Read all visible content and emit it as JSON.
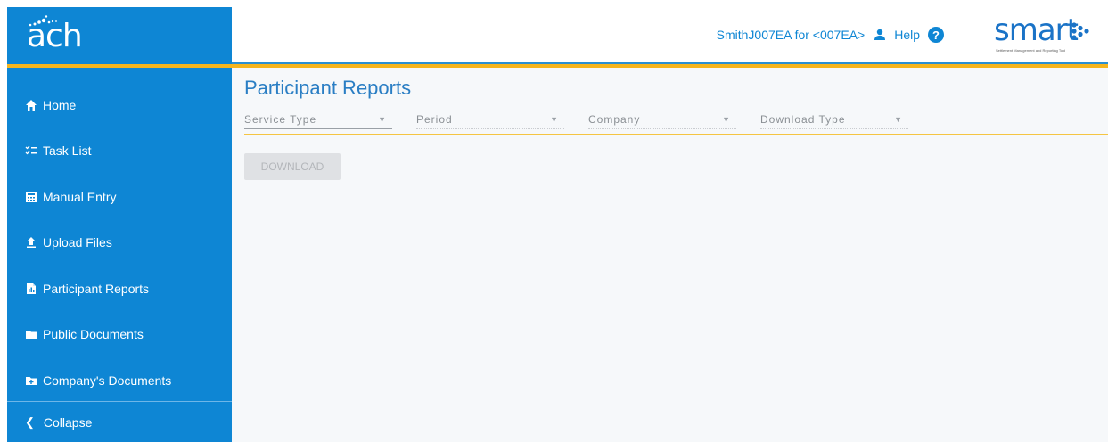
{
  "brand": {
    "left_logo_text": "ach",
    "right_logo_text": "smart",
    "right_logo_tagline": "Settlement Management and Reporting Tool"
  },
  "header": {
    "user_label": "SmithJ007EA for <007EA>",
    "help_label": "Help",
    "help_symbol": "?"
  },
  "sidebar": {
    "items": [
      {
        "label": "Home",
        "icon": "home-icon"
      },
      {
        "label": "Task List",
        "icon": "checklist-icon"
      },
      {
        "label": "Manual Entry",
        "icon": "calculator-icon"
      },
      {
        "label": "Upload Files",
        "icon": "upload-icon"
      },
      {
        "label": "Participant Reports",
        "icon": "report-icon"
      },
      {
        "label": "Public Documents",
        "icon": "folder-icon"
      },
      {
        "label": "Company's Documents",
        "icon": "folder-plus-icon"
      }
    ],
    "collapse_label": "Collapse"
  },
  "main": {
    "title": "Participant Reports",
    "filters": [
      {
        "placeholder": "Service Type"
      },
      {
        "placeholder": "Period"
      },
      {
        "placeholder": "Company"
      },
      {
        "placeholder": "Download Type"
      }
    ],
    "download_label": "DOWNLOAD"
  },
  "colors": {
    "sidebar_bg": "#0e86d4",
    "accent_yellow": "#f5b51d",
    "title_blue": "#2a7ec4"
  }
}
